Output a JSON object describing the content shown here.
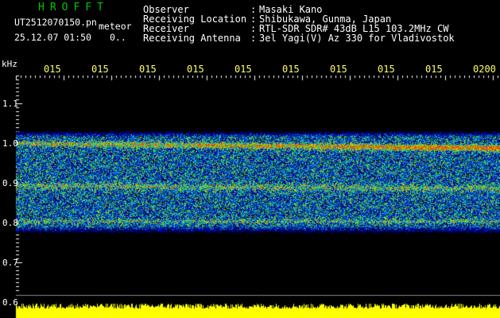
{
  "header": {
    "logo": "HROFFT",
    "filename": "UT2512070150.pn",
    "mode": "meteor",
    "datetime": "25.12.07 01:50",
    "counter": "0.."
  },
  "meta": [
    {
      "label": "Observer",
      "value": "Masaki Kano"
    },
    {
      "label": "Receiving Location",
      "value": "Shibukawa, Gunma, Japan"
    },
    {
      "label": "Receiver",
      "value": "RTL-SDR SDR# 43dB L15 103.2MHz CW"
    },
    {
      "label": "Receiving Antenna",
      "value": "3el Yagi(V) Az 330 for Vladivostok"
    }
  ],
  "axis": {
    "unit": "kHz",
    "y_ticks": [
      "1.1",
      "1.0",
      "0.9",
      "0.8",
      "0.7",
      "0.6"
    ],
    "x_ticks": [
      "015",
      "015",
      "015",
      "015",
      "015",
      "015",
      "015",
      "015",
      "015",
      "0200"
    ]
  },
  "colors": {
    "background": "#000000",
    "tick_label": "#ffff66",
    "logo": "#00c800",
    "text": "#ffffff",
    "noise_bar": "#ffff00"
  }
}
